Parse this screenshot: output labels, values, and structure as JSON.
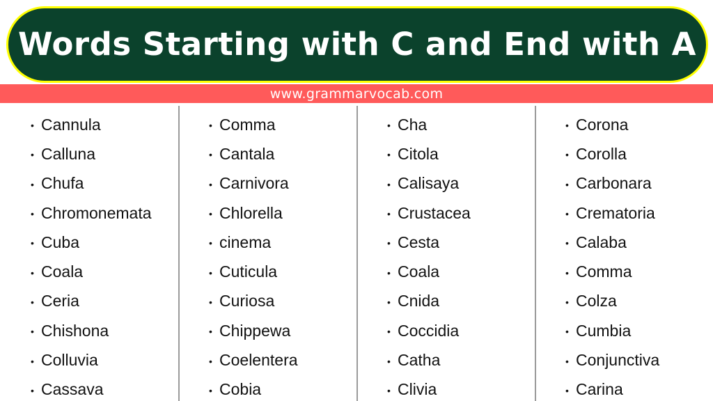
{
  "header": {
    "title": "Words Starting with C and End with A",
    "website": "www.grammarvocab.com"
  },
  "colors": {
    "banner_background": "#0b422c",
    "banner_border": "#ffff00",
    "url_strip": "#ff5a5a",
    "divider": "#9a9a9a",
    "text": "#111111"
  },
  "bullet_icon": "•",
  "columns": [
    {
      "words": [
        "Cannula",
        "Calluna",
        "Chufa",
        "Chromonemata",
        "Cuba",
        "Coala",
        "Ceria",
        "Chishona",
        "Colluvia",
        "Cassava"
      ]
    },
    {
      "words": [
        "Comma",
        "Cantala",
        "Carnivora",
        "Chlorella",
        "cinema",
        "Cuticula",
        "Curiosa",
        "Chippewa",
        "Coelentera",
        "Cobia"
      ]
    },
    {
      "words": [
        "Cha",
        "Citola",
        "Calisaya",
        "Crustacea",
        "Cesta",
        "Coala",
        "Cnida",
        "Coccidia",
        "Catha",
        "Clivia"
      ]
    },
    {
      "words": [
        "Corona",
        "Corolla",
        "Carbonara",
        "Crematoria",
        "Calaba",
        "Comma",
        "Colza",
        "Cumbia",
        "Conjunctiva",
        "Carina"
      ]
    }
  ]
}
